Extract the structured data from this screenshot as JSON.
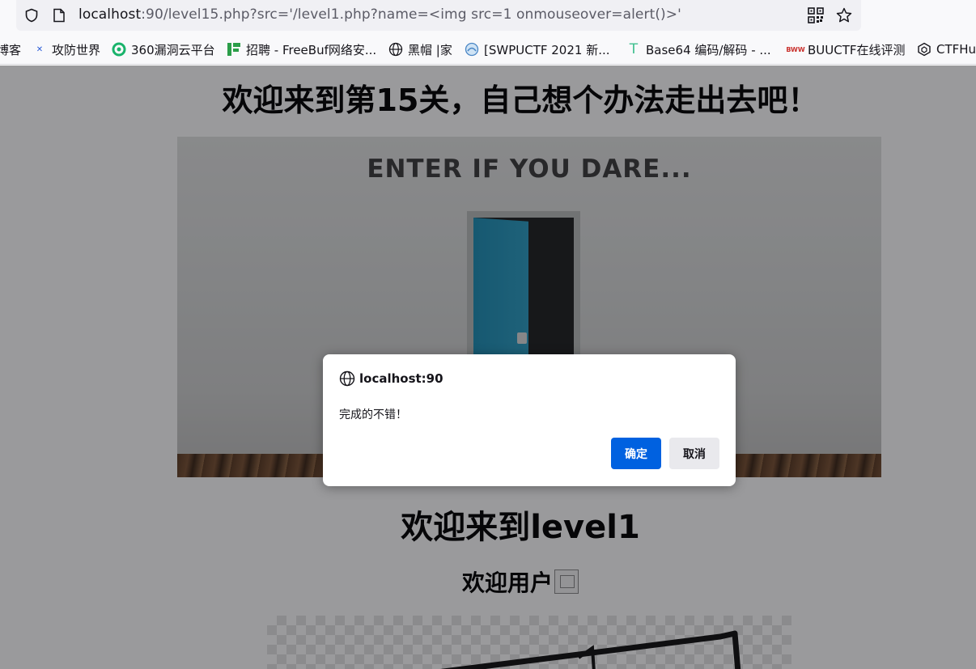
{
  "browser": {
    "url_host": "localhost",
    "url_rest": ":90/level15.php?src='/level1.php?name=<img src=1 onmouseover=alert()>'",
    "bookmarks": [
      {
        "label": "博客",
        "icon": "blog-icon"
      },
      {
        "label": "攻防世界",
        "icon": "adworld-icon"
      },
      {
        "label": "360漏洞云平台",
        "icon": "360-icon"
      },
      {
        "label": "招聘 - FreeBuf网络安...",
        "icon": "freebuf-icon"
      },
      {
        "label": "黑帽 |家",
        "icon": "globe-icon"
      },
      {
        "label": "[SWPUCTF 2021 新...",
        "icon": "nssctf-icon"
      },
      {
        "label": "Base64 编码/解码 - ...",
        "icon": "base64-icon"
      },
      {
        "label": "BUUCTF在线评测",
        "icon": "buuctf-icon"
      },
      {
        "label": "CTFHu",
        "icon": "ctfhub-icon"
      }
    ]
  },
  "page": {
    "title": "欢迎来到第15关，自己想个办法走出去吧！",
    "hero_sign": "ENTER IF YOU DARE...",
    "level_heading": "欢迎来到level1",
    "welcome_user": "欢迎用户"
  },
  "dialog": {
    "origin": "localhost:90",
    "message": "完成的不错！",
    "ok_label": "确定",
    "cancel_label": "取消"
  },
  "colors": {
    "ok_button": "#0061e0",
    "overlay": "rgba(15,15,20,0.42)"
  }
}
